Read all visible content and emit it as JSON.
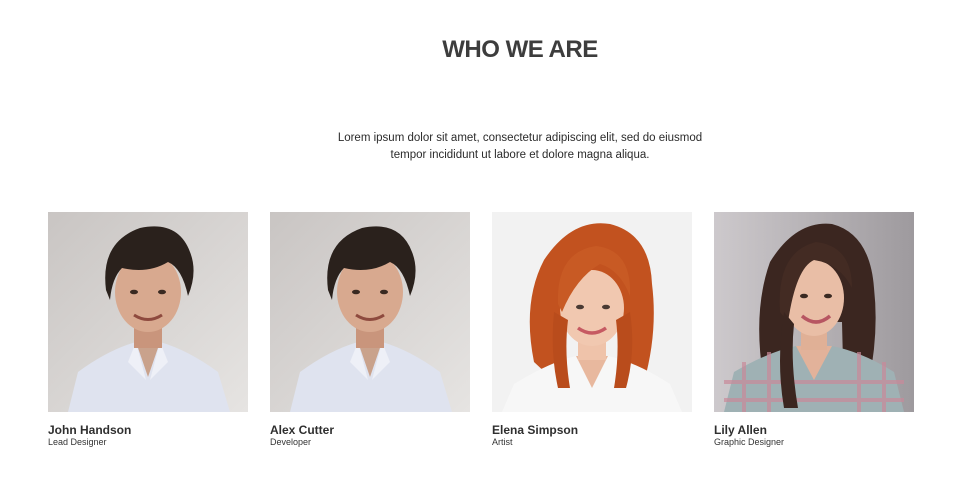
{
  "section": {
    "title": "WHO WE ARE",
    "intro": "Lorem ipsum dolor sit amet, consectetur adipiscing elit, sed do eiusmod tempor incididunt ut labore et dolore magna aliqua."
  },
  "team": [
    {
      "name": "John Handson",
      "role": "Lead Designer",
      "photo_icon": "man-portrait"
    },
    {
      "name": "Alex Cutter",
      "role": "Developer",
      "photo_icon": "man-portrait"
    },
    {
      "name": "Elena Simpson",
      "role": "Artist",
      "photo_icon": "woman-redhead-portrait"
    },
    {
      "name": "Lily Allen",
      "role": "Graphic Designer",
      "photo_icon": "woman-brunette-portrait"
    }
  ],
  "colors": {
    "heading": "#3d3d3d",
    "text": "#2b2b2b",
    "background": "#ffffff"
  }
}
